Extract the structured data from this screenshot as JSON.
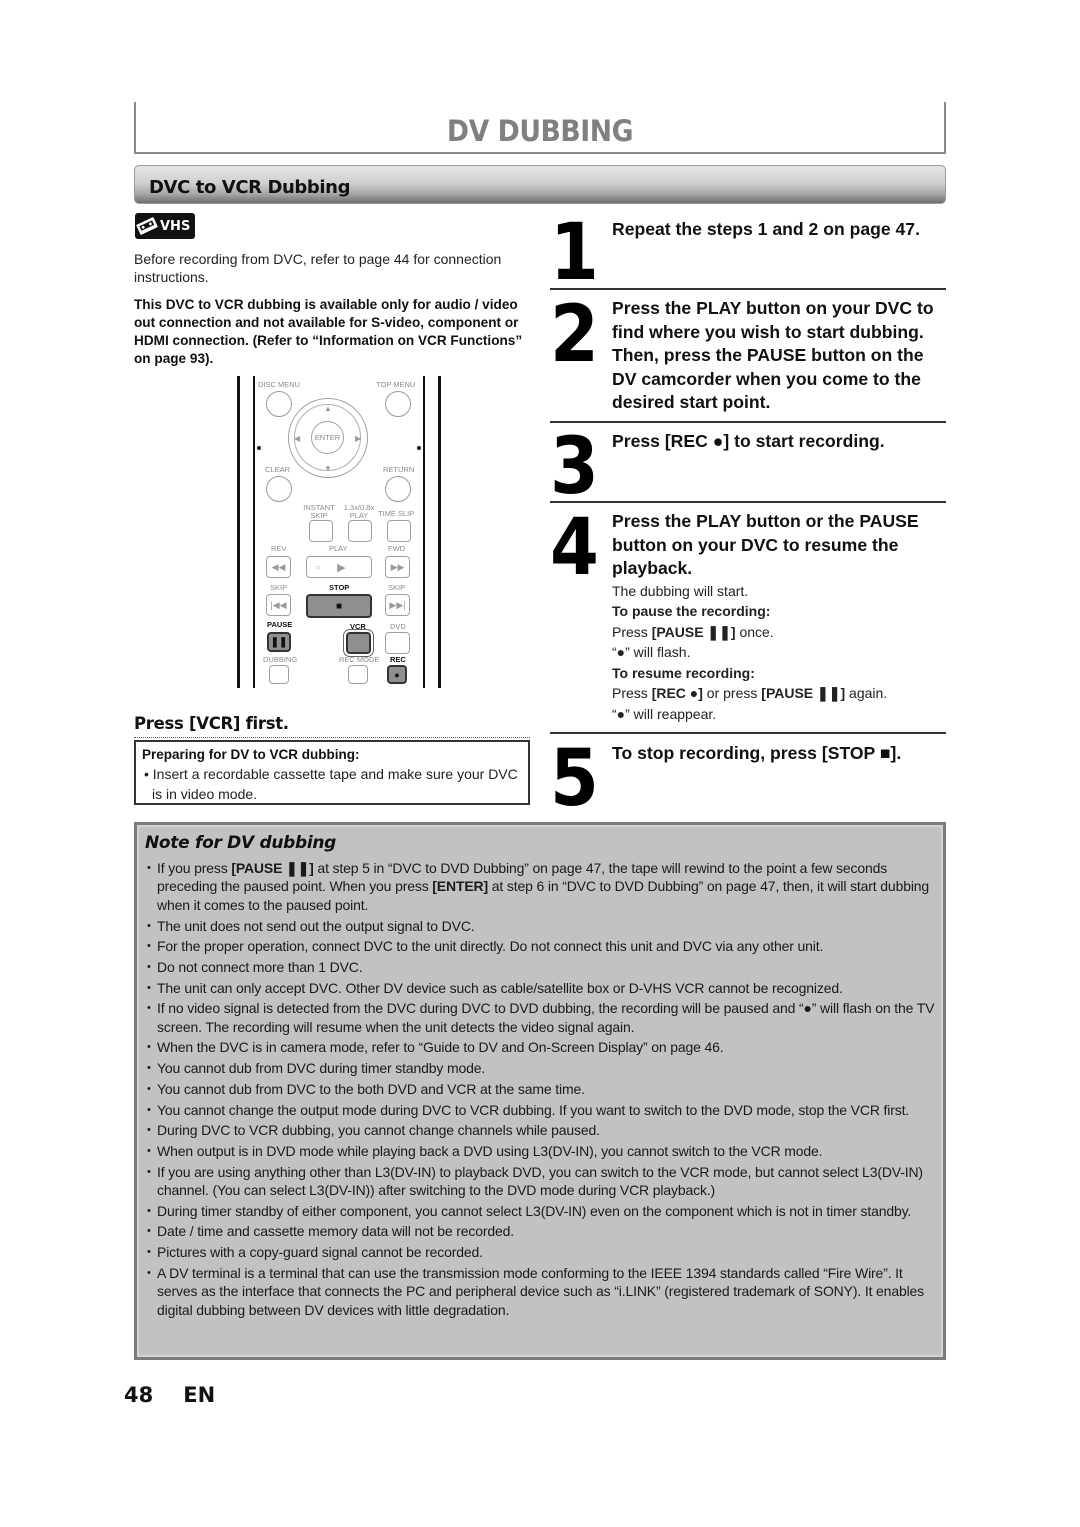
{
  "page": {
    "title": "DV DUBBING",
    "section_title": "DVC to VCR Dubbing",
    "media_badge": {
      "icon": "vhs-cassette-icon",
      "label": "VHS"
    },
    "page_number": "48",
    "language": "EN"
  },
  "left": {
    "intro": "Before recording from DVC, refer to page 44 for connection instructions.",
    "warning": "This DVC to VCR dubbing is available only for audio / video out connection and not available for S-video, component or HDMI connection. (Refer to “Information on VCR Functions” on page 93).",
    "remote": {
      "labels": {
        "disc_menu": "DISC MENU",
        "top_menu": "TOP MENU",
        "enter": "ENTER",
        "clear": "CLEAR",
        "return": "RETURN",
        "instant_skip": "INSTANT SKIP",
        "play_speed": "1.3x/0.8x PLAY",
        "time_slip": "TIME SLIP",
        "rev": "REV",
        "play": "PLAY",
        "fwd": "FWD",
        "skip_back": "SKIP",
        "stop": "STOP",
        "skip_fwd": "SKIP",
        "pause": "PAUSE",
        "vcr": "VCR",
        "dvd": "DVD",
        "dubbing": "DUBBING",
        "rec_mode": "REC MODE",
        "rec": "REC"
      },
      "highlighted_buttons": [
        "STOP",
        "PAUSE",
        "VCR",
        "REC"
      ]
    },
    "press_first": "Press [VCR] first.",
    "prep_box": {
      "heading": "Preparing for DV to VCR dubbing:",
      "bullet": "• Insert a recordable cassette tape and make sure your DVC is in video mode."
    }
  },
  "steps": [
    {
      "number": "1",
      "text": "Repeat the steps 1 and 2 on page 47."
    },
    {
      "number": "2",
      "text": "Press the PLAY button on your DVC to find where you wish to start dubbing. Then, press the PAUSE button on the DV camcorder when you come to the desired start point."
    },
    {
      "number": "3",
      "text": "Press [REC ●] to start recording."
    },
    {
      "number": "4",
      "text": "Press the PLAY button or the PAUSE button on your DVC to resume the playback.",
      "details": {
        "line1": "The dubbing will start.",
        "pause_heading": "To pause the recording:",
        "pause_press_prefix": "Press ",
        "pause_press_key": "[PAUSE ❚❚]",
        "pause_press_suffix": " once.",
        "pause_flash": "“●” will flash.",
        "resume_heading": "To resume recording:",
        "resume_prefix": "Press ",
        "resume_key1": "[REC ●]",
        "resume_mid": " or press ",
        "resume_key2": "[PAUSE ❚❚]",
        "resume_suffix": " again.",
        "resume_reappear": "“●” will reappear."
      }
    },
    {
      "number": "5",
      "text": "To stop recording, press [STOP ■]."
    }
  ],
  "note": {
    "heading": "Note for DV dubbing",
    "items": [
      {
        "pre": "If you press ",
        "b1": "[PAUSE ❚❚]",
        "mid": " at step 5 in “DVC to DVD Dubbing” on page 47, the tape will rewind to the point a few seconds preceding the paused point. When you press ",
        "b2": "[ENTER]",
        "post": " at step 6 in “DVC to DVD Dubbing” on page 47, then, it will start dubbing when it comes to the paused point."
      },
      {
        "text": "The unit does not send out the output signal to DVC."
      },
      {
        "text": "For the proper operation, connect DVC to the unit directly. Do not connect this unit and DVC via any other unit."
      },
      {
        "text": "Do not connect more than 1 DVC."
      },
      {
        "text": "The unit can only accept DVC. Other DV device such as cable/satellite box or D-VHS VCR cannot be recognized."
      },
      {
        "text": "If no video signal is detected from the DVC during DVC to DVD dubbing, the recording will be paused and “●” will flash on the TV screen. The recording will resume when the unit detects the video signal again."
      },
      {
        "text": "When the DVC is in camera mode, refer to “Guide to DV and On-Screen Display” on page 46."
      },
      {
        "text": "You cannot dub from DVC during timer standby mode."
      },
      {
        "text": "You cannot dub from DVC to the both DVD and VCR at the same time."
      },
      {
        "text": "You cannot change the output mode during DVC to VCR dubbing. If you want to switch to the DVD mode, stop the VCR first."
      },
      {
        "text": "During DVC to VCR dubbing, you cannot change channels while paused."
      },
      {
        "text": "When output is in DVD mode while playing back a DVD using L3(DV-IN), you cannot switch to the VCR mode."
      },
      {
        "text": "If you are using anything other than L3(DV-IN) to playback DVD, you can switch to the VCR mode, but cannot select L3(DV-IN) channel. (You can select L3(DV-IN)) after switching to the DVD mode during VCR playback.)"
      },
      {
        "text": "During timer standby of either component, you cannot select L3(DV-IN) even on the component which is not in timer standby."
      },
      {
        "text": "Date / time and cassette memory data will not be recorded."
      },
      {
        "text": "Pictures with a copy-guard signal cannot be recorded."
      },
      {
        "text": "A DV terminal is a terminal that can use the transmission mode conforming to the IEEE 1394 standards called “Fire Wire”. It serves as the interface that connects the PC and peripheral device such as “i.LINK” (registered trademark of SONY). It enables digital dubbing between DV devices with little degradation."
      }
    ]
  },
  "colors": {
    "title_gray": "#808080",
    "note_background": "#c2c2c2",
    "note_border": "#7c7c7c",
    "text": "#111111"
  }
}
